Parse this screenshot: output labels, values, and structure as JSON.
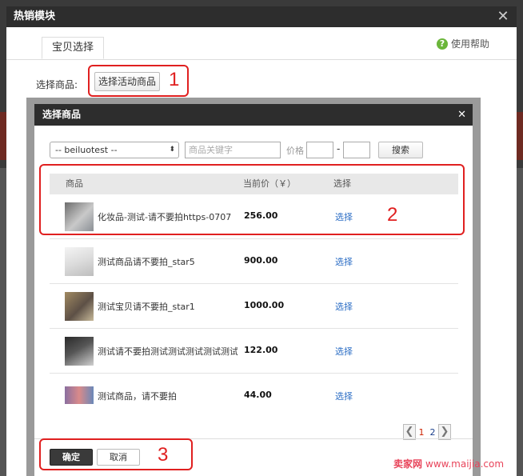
{
  "outer_dialog": {
    "title": "热销模块",
    "close_symbol": "✕",
    "tab_label": "宝贝选择",
    "help_label": "使用帮助",
    "help_icon": "?",
    "pick_label": "选择商品:",
    "pick_button": "选择活动商品"
  },
  "inner_dialog": {
    "title": "选择商品",
    "close_symbol": "✕",
    "shop_select_value": "-- beiluotest --",
    "select_arrow": "⬍",
    "keyword_placeholder": "商品关键字",
    "price_label": "价格",
    "price_dash": "-",
    "search_button": "搜索",
    "table": {
      "headers": [
        "商品",
        "当前价（￥）",
        "选择"
      ],
      "rows": [
        {
          "name": "化妆品-测试-请不要拍https-0707",
          "price": "256.00",
          "action": "选择"
        },
        {
          "name": "测试商品请不要拍_star5",
          "price": "900.00",
          "action": "选择"
        },
        {
          "name": "测试宝贝请不要拍_star1",
          "price": "1000.00",
          "action": "选择"
        },
        {
          "name": "测试请不要拍测试测试测试测试测试",
          "price": "122.00",
          "action": "选择"
        },
        {
          "name": "测试商品，请不要拍",
          "price": "44.00",
          "action": "选择"
        }
      ]
    },
    "pager": {
      "prev": "❮",
      "next": "❯",
      "pages": [
        "1",
        "2"
      ],
      "current": "1"
    },
    "ok_button": "确定",
    "cancel_button": "取消"
  },
  "annotations": [
    "1",
    "2",
    "3"
  ],
  "watermark": {
    "logo": "卖家网",
    "url": "www.maijia.com"
  },
  "colors": {
    "annotation": "#e02020",
    "link": "#2a6cc4",
    "header_dark": "#2d2d2d"
  }
}
